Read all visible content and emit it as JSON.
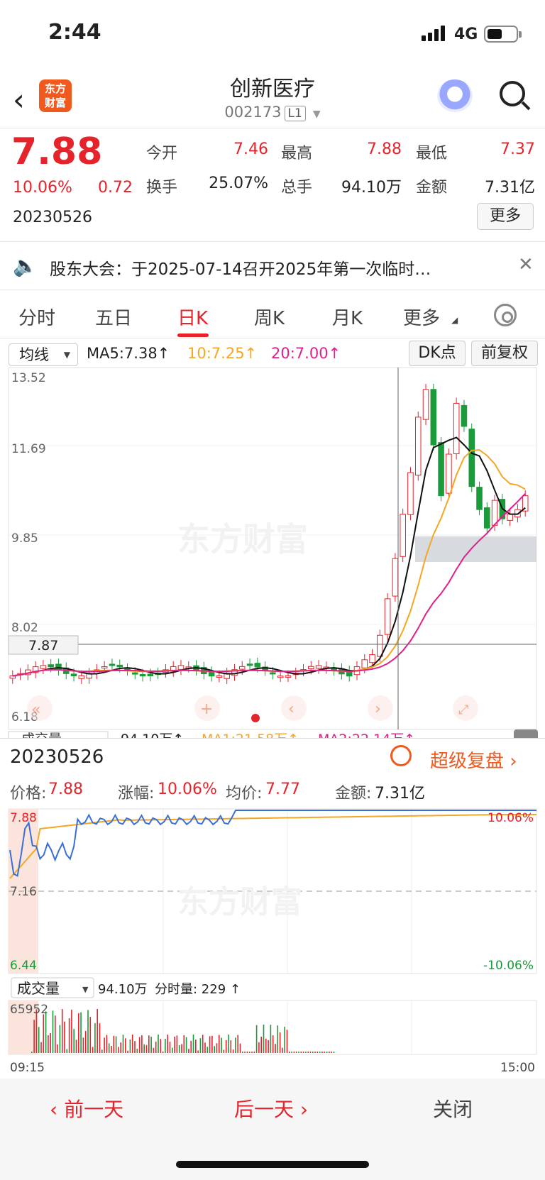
{
  "status": {
    "time": "2:44",
    "network": "4G"
  },
  "header": {
    "title": "创新医疗",
    "code": "002173",
    "level": "L1"
  },
  "quote": {
    "price": "7.88",
    "pct": "10.06%",
    "change": "0.72",
    "date": "20230526",
    "open_label": "今开",
    "open": "7.46",
    "high_label": "最高",
    "high": "7.88",
    "low_label": "最低",
    "low": "7.37",
    "turnover_label": "换手",
    "turnover": "25.07%",
    "volume_label": "总手",
    "volume": "94.10万",
    "amount_label": "金额",
    "amount": "7.31亿",
    "more_label": "更多"
  },
  "notice": {
    "text": "股东大会：于2025-07-14召开2025年第一次临时…"
  },
  "tabs": [
    "分时",
    "五日",
    "日K",
    "周K",
    "月K",
    "更多"
  ],
  "ma_bar": {
    "selector": "均线",
    "ma5": "MA5:7.38↑",
    "ma10": "10:7.25↑",
    "ma20": "20:7.00↑",
    "dk": "DK点",
    "adjust": "前复权"
  },
  "kline": {
    "y_labels": [
      "13.52",
      "11.69",
      "9.85",
      "8.02",
      "6.18"
    ],
    "cursor_price": "7.87",
    "watermark": "东方财富",
    "colors": {
      "up": "#e5232b",
      "down": "#1b9b3a",
      "ma5": "#111111",
      "ma10": "#f5a623",
      "ma20": "#e0208a"
    }
  },
  "vol_row_partial": {
    "label": "成交量",
    "value": "94.10万↑",
    "ma1": "MA1:21.58万↑",
    "ma2": "MA2:22.14万↑"
  },
  "popup": {
    "date": "20230526",
    "replay": "超级复盘",
    "price_label": "价格:",
    "price": "7.88",
    "pct_label": "涨幅:",
    "pct": "10.06%",
    "avg_label": "均价:",
    "avg": "7.77",
    "amount_label": "金额:",
    "amount": "7.31亿",
    "y_top": "7.88",
    "y_mid": "7.16",
    "y_bot": "6.44",
    "pct_top": "10.06%",
    "pct_bot": "-10.06%",
    "vol_selector": "成交量",
    "vol_total": "94.10万",
    "vol_min": "分时量: 229 ↑",
    "vol_max": "65952",
    "time_start": "09:15",
    "time_end": "15:00"
  },
  "bottom_nav": {
    "prev": "前一天",
    "next": "后一天",
    "close": "关闭"
  }
}
